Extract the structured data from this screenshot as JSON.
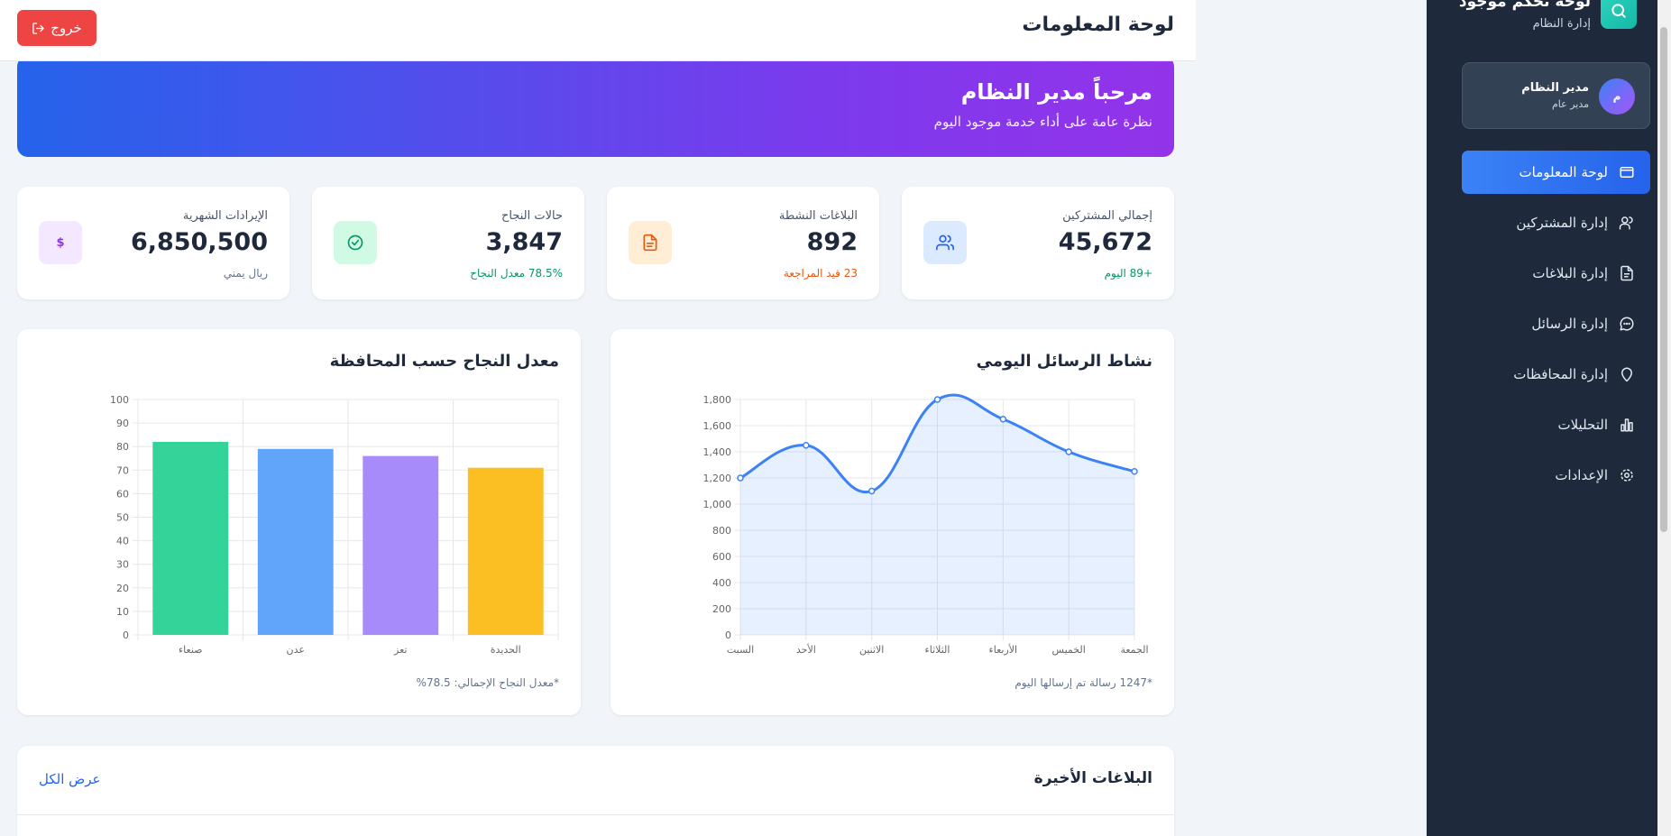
{
  "header": {
    "title": "لوحة المعلومات",
    "logout_label": "خروج"
  },
  "welcome": {
    "title": "مرحباً مدير النظام",
    "subtitle": "نظرة عامة على أداء خدمة موجود اليوم"
  },
  "stats": [
    {
      "label": "إجمالي المشتركين",
      "value": "45,672",
      "sub": "+89 اليوم",
      "sub_color": "#059669",
      "icon": "users-icon",
      "icon_bg": "#dbeafe",
      "icon_color": "#2563eb"
    },
    {
      "label": "البلاغات النشطة",
      "value": "892",
      "sub": "23 قيد المراجعة",
      "sub_color": "#ea580c",
      "icon": "document-icon",
      "icon_bg": "#ffedd5",
      "icon_color": "#ea580c"
    },
    {
      "label": "حالات النجاح",
      "value": "3,847",
      "sub": "78.5% معدل النجاح",
      "sub_color": "#059669",
      "icon": "check-circle-icon",
      "icon_bg": "#d1fae5",
      "icon_color": "#059669"
    },
    {
      "label": "الإيرادات الشهرية",
      "value": "6,850,500",
      "sub": "ريال يمني",
      "sub_color": "#64748b",
      "icon": "dollar-icon",
      "icon_bg": "#f3e8ff",
      "icon_color": "#9333ea",
      "icon_text": "$"
    }
  ],
  "messages_chart": {
    "title": "نشاط الرسائل اليومي",
    "note": "*1247 رسالة تم إرسالها اليوم"
  },
  "success_chart": {
    "title": "معدل النجاح حسب المحافظة",
    "note": "*معدل النجاح الإجمالي: 78.5%"
  },
  "chart_data": [
    {
      "type": "line",
      "title": "نشاط الرسائل اليومي",
      "categories": [
        "السبت",
        "الأحد",
        "الاثنين",
        "الثلاثاء",
        "الأربعاء",
        "الخميس",
        "الجمعة"
      ],
      "values": [
        1200,
        1450,
        1100,
        1800,
        1650,
        1400,
        1250
      ],
      "ylim": [
        0,
        1800
      ],
      "yticks": [
        "0",
        "200",
        "400",
        "600",
        "800",
        "1,000",
        "1,200",
        "1,400",
        "1,600",
        "1,800"
      ],
      "grid": true,
      "fill": true,
      "color": "#3b82f6"
    },
    {
      "type": "bar",
      "title": "معدل النجاح حسب المحافظة",
      "categories": [
        "صنعاء",
        "عدن",
        "تعز",
        "الحديدة"
      ],
      "values": [
        82,
        79,
        76,
        71
      ],
      "colors": [
        "#34d399",
        "#60a5fa",
        "#a78bfa",
        "#fbbf24"
      ],
      "ylim": [
        0,
        100
      ],
      "yticks": [
        "0",
        "10",
        "20",
        "30",
        "40",
        "50",
        "60",
        "70",
        "80",
        "90",
        "100"
      ],
      "grid": true
    }
  ],
  "reports": {
    "title": "البلاغات الأخيرة",
    "view_all": "عرض الكل"
  },
  "sidebar": {
    "brand_title": "لوحة تحكم موجود",
    "brand_subtitle": "إدارة النظام",
    "user": {
      "initial": "م",
      "name": "مدير النظام",
      "role": "مدير عام"
    },
    "items": [
      {
        "label": "لوحة المعلومات",
        "icon": "folder-icon",
        "active": true
      },
      {
        "label": "إدارة المشتركين",
        "icon": "users-icon",
        "active": false
      },
      {
        "label": "إدارة البلاغات",
        "icon": "document-icon",
        "active": false
      },
      {
        "label": "إدارة الرسائل",
        "icon": "chat-icon",
        "active": false
      },
      {
        "label": "إدارة المحافظات",
        "icon": "map-pin-icon",
        "active": false
      },
      {
        "label": "التحليلات",
        "icon": "bar-chart-icon",
        "active": false
      },
      {
        "label": "الإعدادات",
        "icon": "gear-icon",
        "active": false
      }
    ]
  }
}
